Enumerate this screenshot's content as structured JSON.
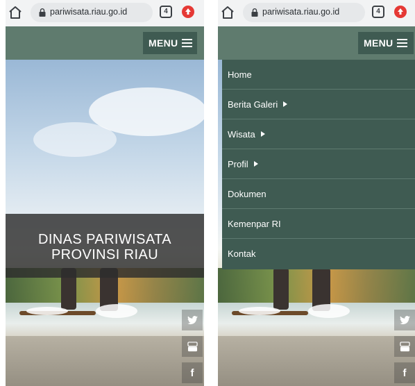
{
  "browser": {
    "url": "pariwisata.riau.go.id",
    "tab_count": "4"
  },
  "header": {
    "menu_label": "MENU"
  },
  "banner": {
    "line1": "DINAS PARIWISATA",
    "line2": "PROVINSI RIAU"
  },
  "nav": {
    "items": [
      {
        "label": "Home",
        "has_submenu": false
      },
      {
        "label": "Berita Galeri",
        "has_submenu": true
      },
      {
        "label": "Wisata",
        "has_submenu": true
      },
      {
        "label": "Profil",
        "has_submenu": true
      },
      {
        "label": "Dokumen",
        "has_submenu": false
      },
      {
        "label": "Kemenpar RI",
        "has_submenu": false
      },
      {
        "label": "Kontak",
        "has_submenu": false
      }
    ]
  },
  "social": {
    "facebook_glyph": "f",
    "icons": [
      "twitter-icon",
      "youtube-icon",
      "facebook-icon"
    ]
  },
  "colors": {
    "header_bg": "#5f7b6e",
    "menu_bg": "#3f5b52",
    "banner_bg": "#2d2d2d"
  }
}
